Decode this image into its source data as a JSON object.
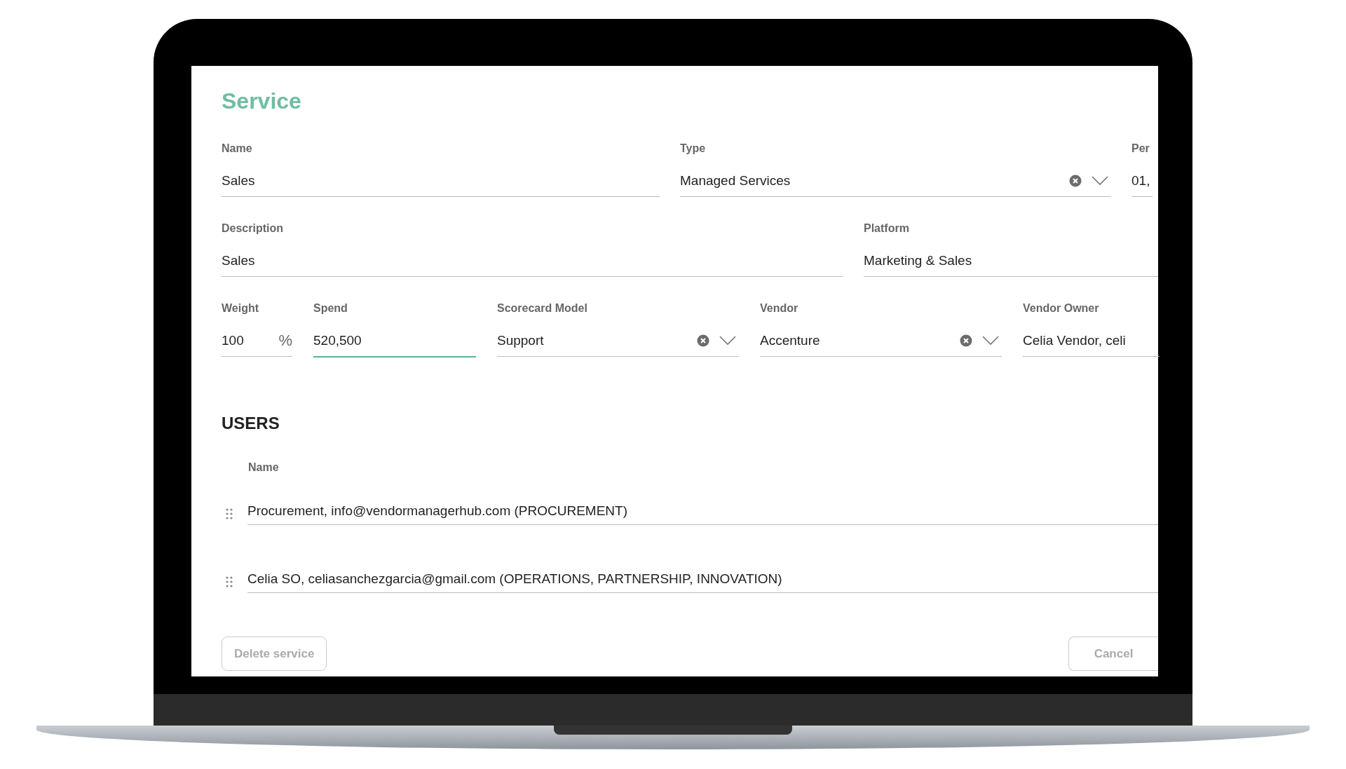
{
  "title": "Service",
  "field_rows": [
    [
      {
        "label": "Name",
        "value": "Sales",
        "kind": "text",
        "focused": false
      },
      {
        "label": "Type",
        "value": "Managed Services",
        "kind": "select",
        "focused": false
      },
      {
        "label": "Per",
        "value": "01,",
        "kind": "text",
        "focused": false
      }
    ],
    [
      {
        "label": "Description",
        "value": "Sales",
        "kind": "text",
        "focused": false
      },
      {
        "label": "Platform",
        "value": "Marketing & Sales",
        "kind": "text",
        "focused": false
      }
    ],
    [
      {
        "label": "Weight",
        "value": "100",
        "kind": "percent",
        "suffix": "%",
        "focused": false
      },
      {
        "label": "Spend",
        "value": "520,500",
        "kind": "text",
        "focused": true
      },
      {
        "label": "Scorecard Model",
        "value": "Support",
        "kind": "select",
        "focused": false
      },
      {
        "label": "Vendor",
        "value": "Accenture",
        "kind": "select",
        "focused": false
      },
      {
        "label": "Vendor Owner",
        "value": "Celia Vendor, celi",
        "kind": "text",
        "focused": false
      }
    ]
  ],
  "users": {
    "heading": "USERS",
    "column": "Name",
    "rows": [
      "Procurement, info@vendormanagerhub.com (PROCUREMENT)",
      "Celia SO, celiasanchezgarcia@gmail.com (OPERATIONS, PARTNERSHIP, INNOVATION)"
    ]
  },
  "buttons": {
    "delete": "Delete service",
    "cancel": "Cancel"
  }
}
